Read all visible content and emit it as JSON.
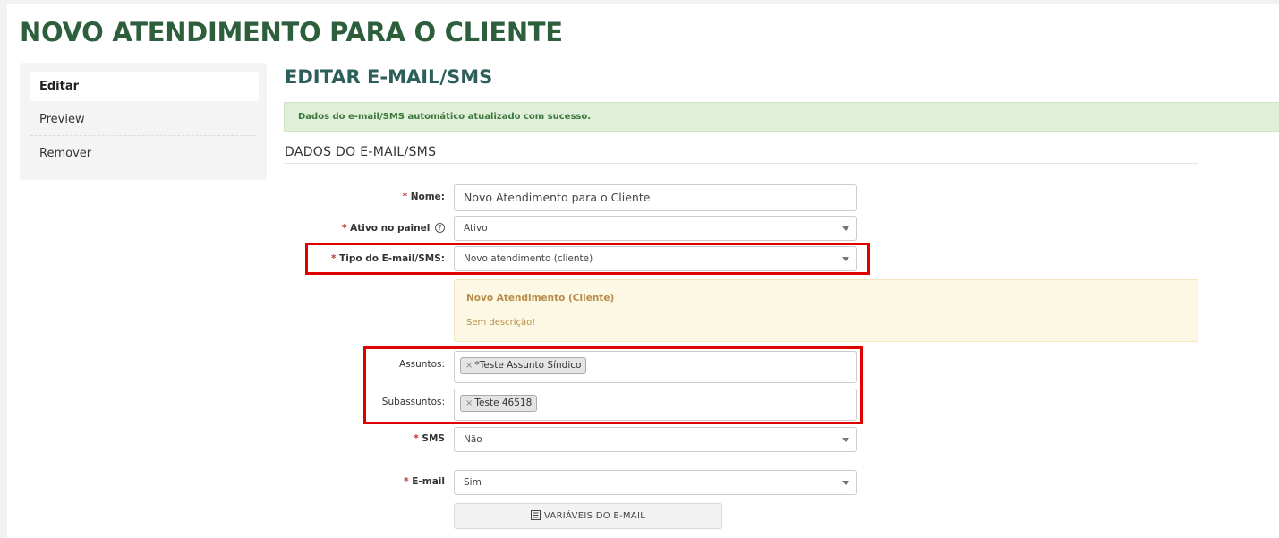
{
  "page": {
    "title": "NOVO ATENDIMENTO PARA O CLIENTE"
  },
  "sidebar": {
    "items": [
      {
        "label": "Editar",
        "active": true
      },
      {
        "label": "Preview",
        "active": false
      },
      {
        "label": "Remover",
        "active": false
      }
    ]
  },
  "main": {
    "section_title": "EDITAR E-MAIL/SMS",
    "success_message": "Dados do e-mail/SMS automático atualizado com sucesso.",
    "subsection_title": "DADOS DO E-MAIL/SMS"
  },
  "form": {
    "required_mark": "*",
    "nome": {
      "label": "Nome:",
      "value": "Novo Atendimento para o Cliente"
    },
    "ativo": {
      "label": "Ativo no painel",
      "help_icon": "?",
      "value": "Ativo"
    },
    "tipo": {
      "label": "Tipo do E-mail/SMS:",
      "value": "Novo atendimento (cliente)"
    },
    "tipo_info": {
      "title": "Novo Atendimento (Cliente)",
      "description": "Sem descrição!"
    },
    "assuntos": {
      "label": "Assuntos:",
      "tag_remove": "×",
      "tags": [
        "*Teste Assunto Síndico"
      ]
    },
    "subassuntos": {
      "label": "Subassuntos:",
      "tag_remove": "×",
      "tags": [
        "Teste 46518"
      ]
    },
    "sms": {
      "label": "SMS",
      "value": "Não"
    },
    "email": {
      "label": "E-mail",
      "value": "Sim"
    },
    "variables_button": {
      "label": "VARIÁVEIS DO E-MAIL",
      "icon": "list-icon"
    }
  },
  "colors": {
    "title_green": "#2d5f3c",
    "section_teal": "#2d5f5a",
    "success_bg": "#e0efd8",
    "success_text": "#3c763d",
    "info_bg": "#fcf8e3",
    "info_text": "#b88c4a",
    "highlight_red": "#e00000",
    "required_red": "#c9302c"
  }
}
